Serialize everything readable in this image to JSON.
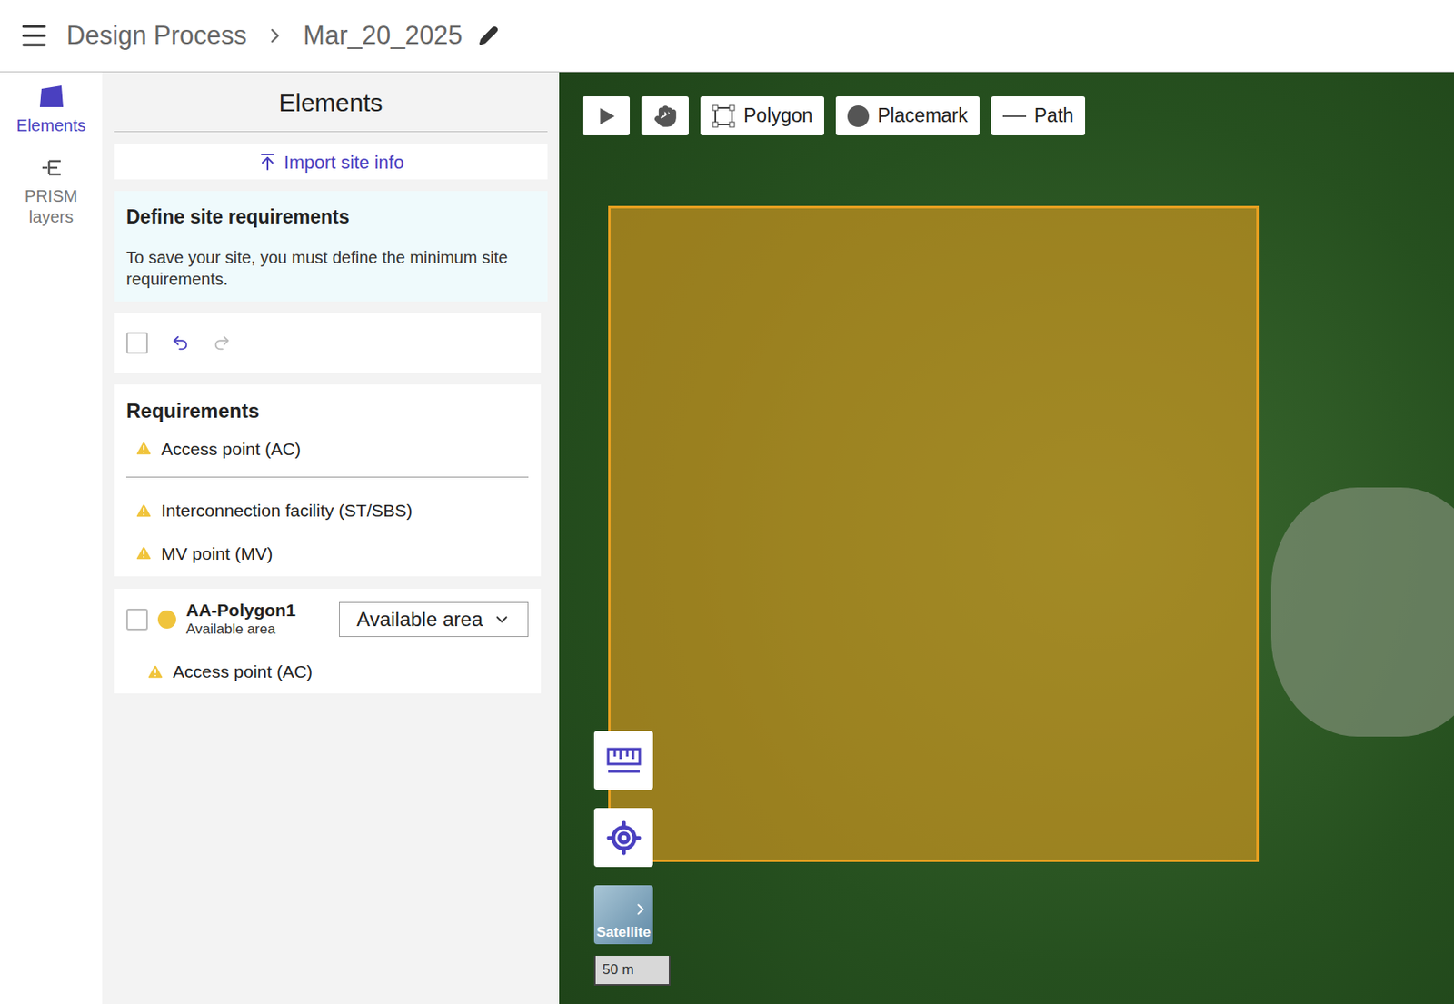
{
  "header": {
    "menu": "☰",
    "breadcrumb": [
      "Design Process",
      "Mar_20_2025"
    ]
  },
  "rail": {
    "items": [
      {
        "label": "Elements",
        "selected": true
      },
      {
        "label": "PRISM layers",
        "selected": false
      }
    ]
  },
  "panel": {
    "title": "Elements",
    "import_button": "Import site info",
    "info": {
      "title": "Define site requirements",
      "text": "To save your site, you must define the minimum site requirements."
    },
    "toolbar": {
      "select_all_checked": false,
      "undo_disabled": false,
      "redo_disabled": true
    },
    "requirements": {
      "title": "Requirements",
      "groups": [
        [
          "Access point (AC)"
        ],
        [
          "Interconnection facility (ST/SBS)",
          "MV point (MV)"
        ]
      ]
    },
    "elements": [
      {
        "name": "AA-Polygon1",
        "subtitle": "Available area",
        "checked": false,
        "color": "#f0c43c",
        "type": "Available area",
        "warnings": [
          "Access point (AC)"
        ]
      }
    ]
  },
  "map": {
    "tools": [
      {
        "label": "",
        "kind": "select"
      },
      {
        "label": "",
        "kind": "pan"
      },
      {
        "label": "Polygon",
        "kind": "polygon"
      },
      {
        "label": "Placemark",
        "kind": "placemark"
      },
      {
        "label": "Path",
        "kind": "path"
      }
    ],
    "polygon": {
      "color": "#e8a020"
    },
    "basemap": "Satellite",
    "scale": "50 m"
  }
}
